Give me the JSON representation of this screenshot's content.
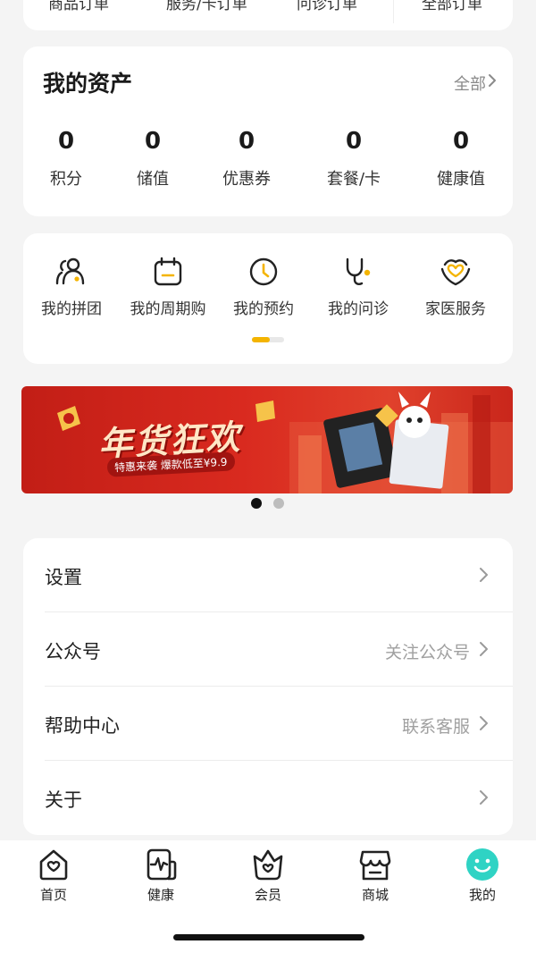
{
  "top_partial": {
    "items": [
      "商品订单",
      "服务/卡订单",
      "问诊订单",
      "全部订单"
    ]
  },
  "assets": {
    "title": "我的资产",
    "all_label": "全部",
    "items": [
      {
        "value": "0",
        "label": "积分"
      },
      {
        "value": "0",
        "label": "储值"
      },
      {
        "value": "0",
        "label": "优惠券"
      },
      {
        "value": "0",
        "label": "套餐/卡"
      },
      {
        "value": "0",
        "label": "健康值"
      }
    ]
  },
  "services": {
    "items": [
      {
        "label": "我的拼团",
        "icon": "group-buy-icon"
      },
      {
        "label": "我的周期购",
        "icon": "calendar-icon"
      },
      {
        "label": "我的预约",
        "icon": "clock-icon"
      },
      {
        "label": "我的问诊",
        "icon": "stethoscope-icon"
      },
      {
        "label": "家医服务",
        "icon": "heart-hands-icon"
      }
    ],
    "page_indicator": {
      "pages": 2,
      "active": 0
    }
  },
  "banner": {
    "title": "年货狂欢",
    "subtitle": "特惠来袭 爆款低至¥9.9",
    "dots": {
      "count": 2,
      "active": 0
    }
  },
  "settings": {
    "rows": [
      {
        "title": "设置",
        "hint": ""
      },
      {
        "title": "公众号",
        "hint": "关注公众号"
      },
      {
        "title": "帮助中心",
        "hint": "联系客服"
      },
      {
        "title": "关于",
        "hint": ""
      }
    ]
  },
  "tabbar": {
    "items": [
      {
        "label": "首页",
        "icon": "home-icon"
      },
      {
        "label": "健康",
        "icon": "health-icon"
      },
      {
        "label": "会员",
        "icon": "member-icon"
      },
      {
        "label": "商城",
        "icon": "shop-icon"
      },
      {
        "label": "我的",
        "icon": "profile-icon"
      }
    ],
    "active": 4
  },
  "colors": {
    "accent_yellow": "#f4b400",
    "profile_teal": "#2fd3c4",
    "banner_red": "#c21e16"
  }
}
